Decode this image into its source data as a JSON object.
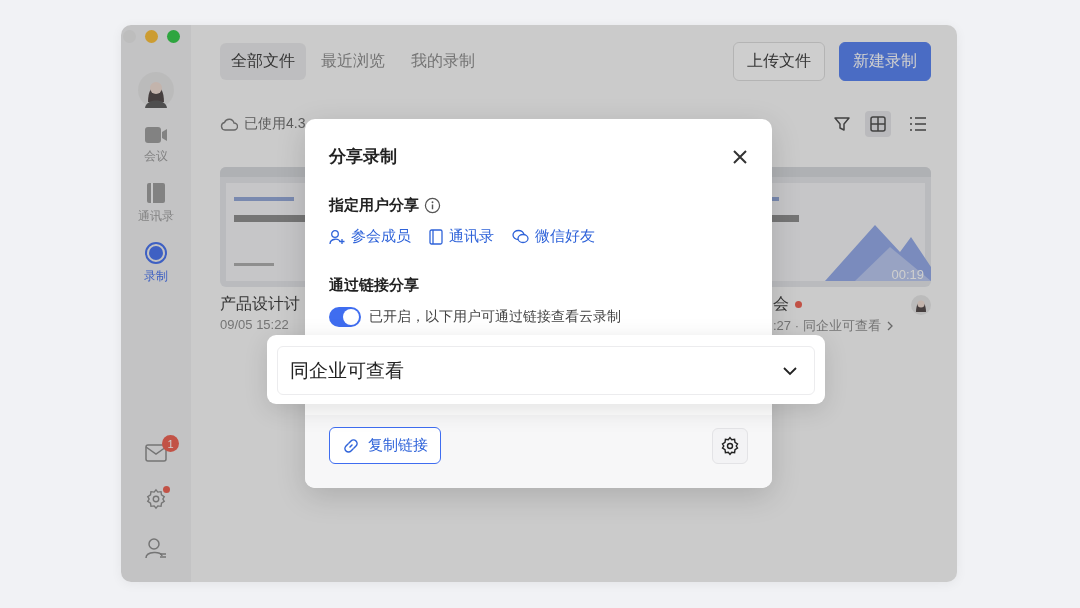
{
  "sidebar": {
    "items": [
      {
        "kind": "meeting",
        "label": "会议",
        "selected": false
      },
      {
        "kind": "contacts",
        "label": "通讯录",
        "selected": false
      },
      {
        "kind": "record",
        "label": "录制",
        "selected": true
      }
    ],
    "mail_badge": "1",
    "settings_dot": true
  },
  "tabs": [
    {
      "label": "全部文件",
      "selected": true
    },
    {
      "label": "最近浏览",
      "selected": false
    },
    {
      "label": "我的录制",
      "selected": false
    }
  ],
  "actions": [
    {
      "kind": "secondary",
      "label": "上传文件"
    },
    {
      "kind": "primary",
      "label": "新建录制"
    }
  ],
  "storage": {
    "text": "已使用4.3"
  },
  "view_modes": [
    {
      "kind": "grid",
      "selected": true
    },
    {
      "kind": "list",
      "selected": false
    }
  ],
  "recordings": [
    {
      "title": "产品设计讨",
      "meta": "09/05 15:22",
      "unread": false,
      "partly_hidden": false
    },
    {
      "title": "会",
      "meta": ":27 · 同企业可查看",
      "duration": "00:19",
      "unread": true,
      "partly_hidden": true
    }
  ],
  "share_dialog": {
    "title": "分享录制",
    "user_share": {
      "heading": "指定用户分享",
      "options": [
        {
          "kind": "members",
          "label": "参会成员"
        },
        {
          "kind": "contacts",
          "label": "通讯录"
        },
        {
          "kind": "wechat",
          "label": "微信好友"
        }
      ]
    },
    "link_share": {
      "heading": "通过链接分享",
      "enabled": true,
      "description": "已开启，以下用户可通过链接查看云录制",
      "scope": "同企业可查看"
    },
    "copy_button": "复制链接"
  }
}
